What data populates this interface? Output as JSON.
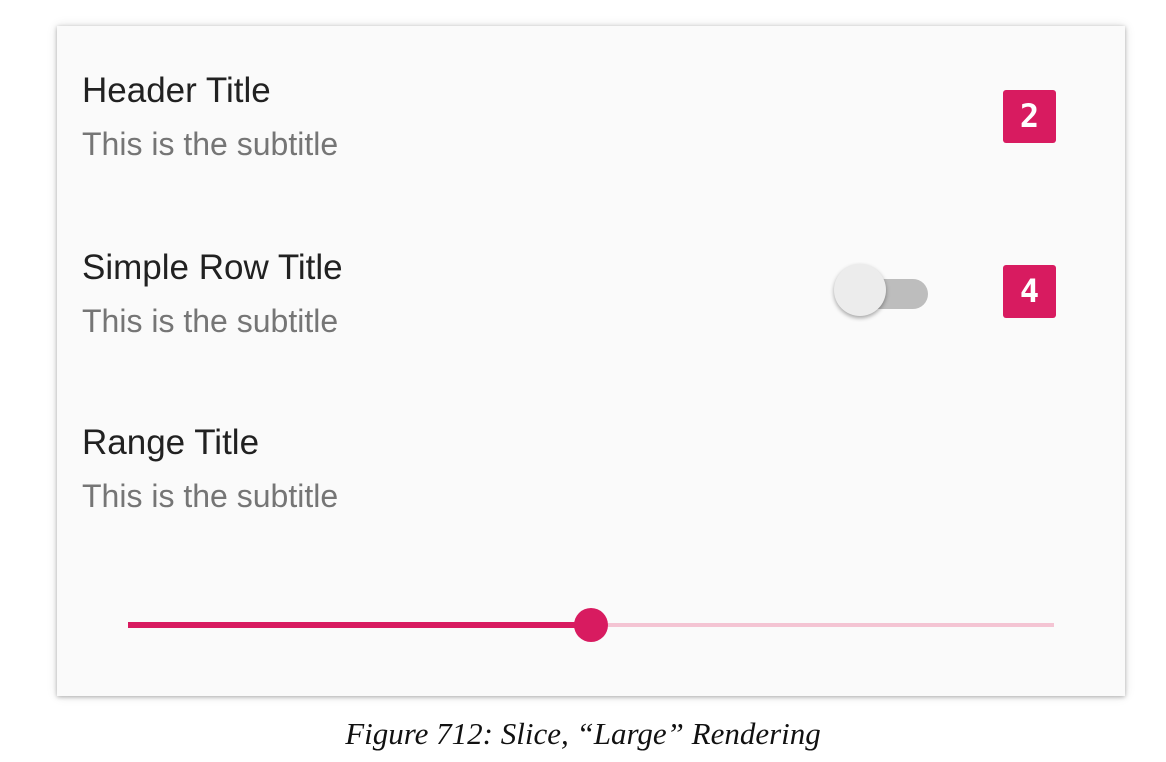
{
  "slice": {
    "header": {
      "title": "Header Title",
      "subtitle": "This is the subtitle",
      "badge": "2"
    },
    "simple_row": {
      "title": "Simple Row Title",
      "subtitle": "This is the subtitle",
      "toggle_on": false,
      "badge": "4"
    },
    "range": {
      "title": "Range Title",
      "subtitle": "This is the subtitle",
      "value_fraction": 0.5
    }
  },
  "caption": "Figure 712: Slice, “Large” Rendering",
  "colors": {
    "accent": "#d81b60",
    "accent_light": "#f4c4d3",
    "toggle_track_off": "#bdbdbd",
    "toggle_thumb_off": "#ececec",
    "card_background": "#fafafa",
    "title_text": "#212121",
    "subtitle_text": "#757575"
  }
}
